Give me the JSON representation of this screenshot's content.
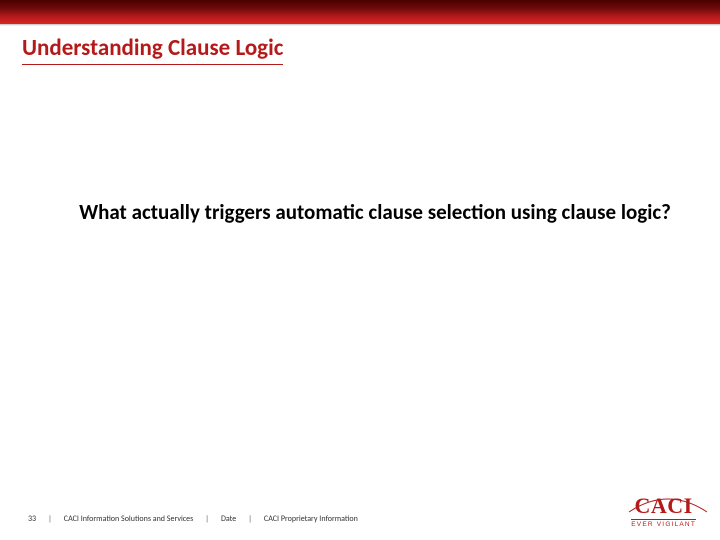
{
  "title": "Understanding Clause Logic",
  "body": "What actually triggers automatic clause selection using clause logic?",
  "footer": {
    "page": "33",
    "org": "CACI Information Solutions and Services",
    "date": "Date",
    "note": "CACI Proprietary Information"
  },
  "logo": {
    "name": "CACI",
    "tagline": "EVER VIGILANT"
  },
  "colors": {
    "accent": "#b51a1a"
  }
}
